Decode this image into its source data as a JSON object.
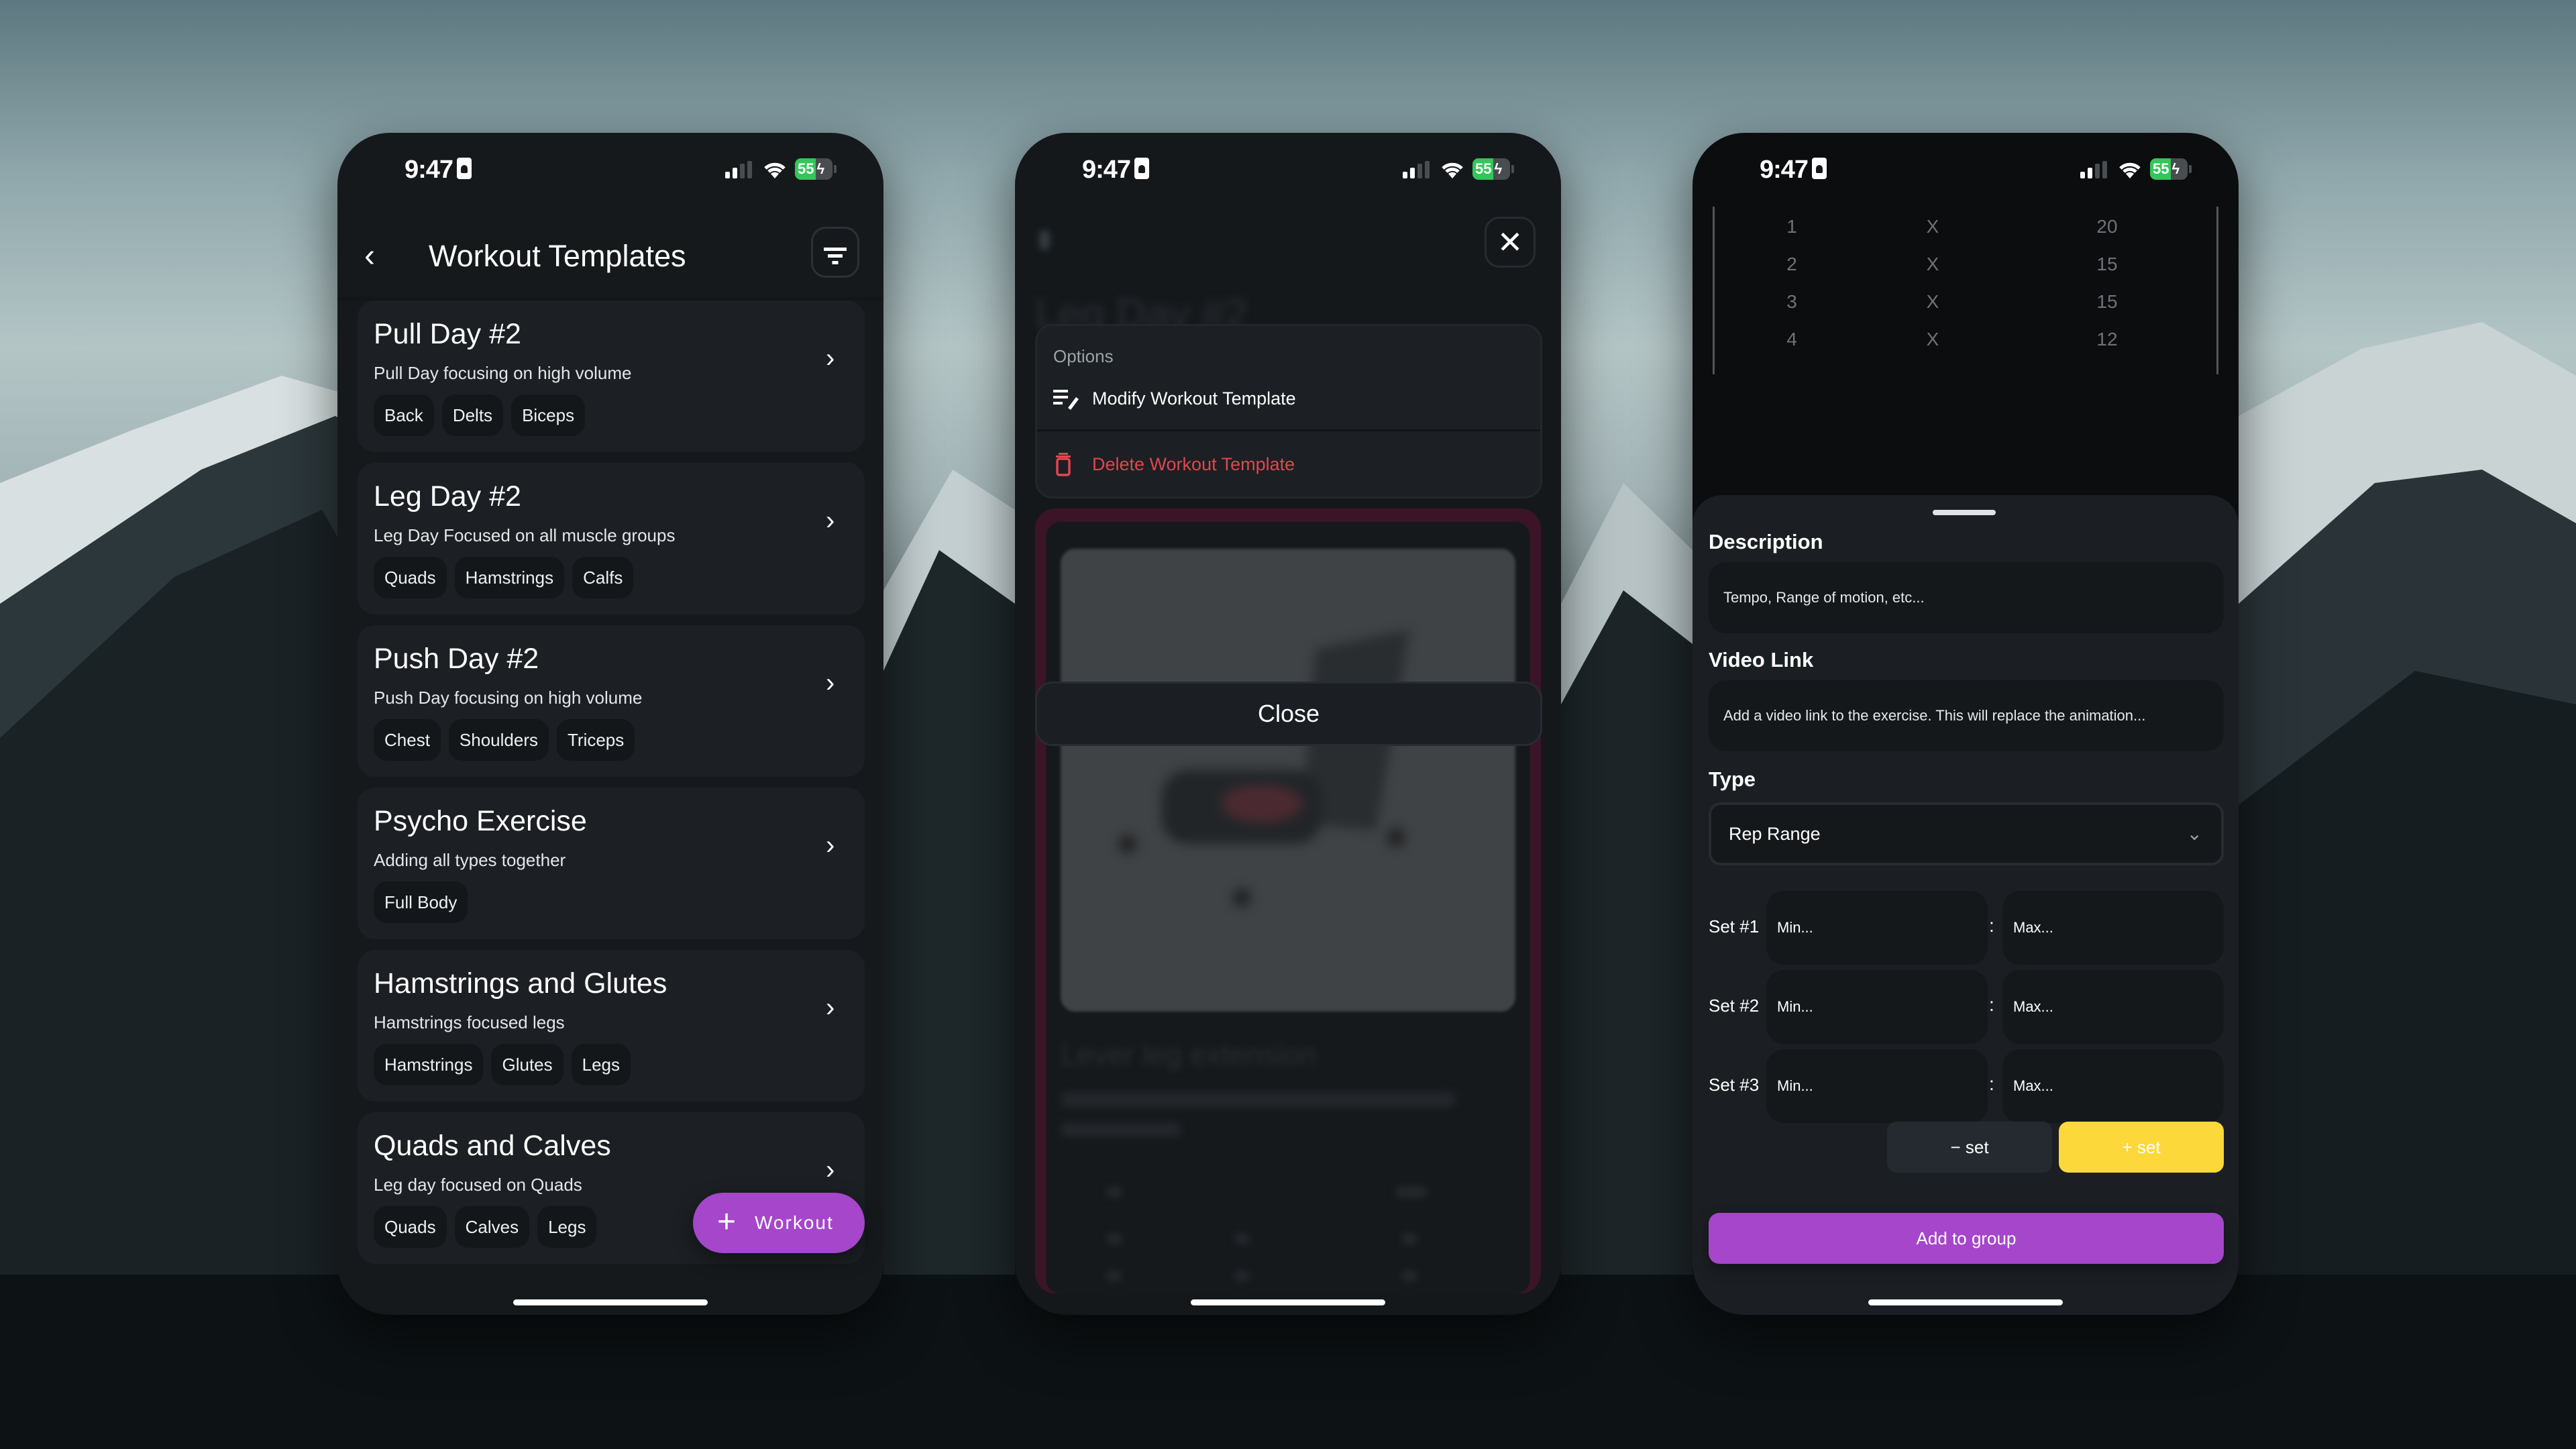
{
  "colors": {
    "accent_purple": "#a546cb",
    "accent_yellow": "#fdd83a",
    "danger_red": "#e0474d",
    "battery_green": "#33c759",
    "card_bg": "#1c1f23",
    "screen_bg": "#16191c"
  },
  "status_bar": {
    "time": "9:47",
    "battery_level": "55",
    "signal_bars_active": 2,
    "signal_bars_total": 4,
    "battery_fraction": 0.55,
    "charging": true
  },
  "screen1": {
    "header": {
      "back_icon": "chevron-left-icon",
      "title": "Workout Templates",
      "filter_icon": "filter-icon"
    },
    "templates": [
      {
        "title": "Pull Day #2",
        "description": "Pull Day focusing on high volume",
        "tags": [
          "Back",
          "Delts",
          "Biceps"
        ]
      },
      {
        "title": "Leg Day #2",
        "description": "Leg Day Focused on all muscle groups",
        "tags": [
          "Quads",
          "Hamstrings",
          "Calfs"
        ]
      },
      {
        "title": "Push Day #2",
        "description": "Push Day focusing on high volume",
        "tags": [
          "Chest",
          "Shoulders",
          "Triceps"
        ]
      },
      {
        "title": "Psycho Exercise",
        "description": "Adding all types together",
        "tags": [
          "Full Body"
        ]
      },
      {
        "title": "Hamstrings and Glutes",
        "description": "Hamstrings focused legs",
        "tags": [
          "Hamstrings",
          "Glutes",
          "Legs"
        ]
      },
      {
        "title": "Quads and Calves",
        "description": "Leg day focused on Quads",
        "tags": [
          "Quads",
          "Calves",
          "Legs"
        ]
      }
    ],
    "chevron_glyph": "›",
    "fab": {
      "plus": "+",
      "label": "Workout"
    }
  },
  "screen2": {
    "background_title": "Leg Day #2",
    "background_exercise_title": "Lever leg extension",
    "close_icon": "✕",
    "options_sheet": {
      "header": "Options",
      "items": [
        {
          "label": "Modify Workout Template",
          "icon": "edit-list-icon"
        },
        {
          "label": "Delete Workout Template",
          "icon": "trash-icon",
          "danger": true
        }
      ]
    },
    "close_button": "Close"
  },
  "screen3": {
    "sets_table": [
      {
        "set": "1",
        "x": "X",
        "reps": "20"
      },
      {
        "set": "2",
        "x": "X",
        "reps": "15"
      },
      {
        "set": "3",
        "x": "X",
        "reps": "15"
      },
      {
        "set": "4",
        "x": "X",
        "reps": "12"
      }
    ],
    "description": {
      "label": "Description",
      "placeholder": "Tempo, Range of motion, etc..."
    },
    "video_link": {
      "label": "Video Link",
      "placeholder": "Add a video link to the exercise. This will replace the animation..."
    },
    "type": {
      "label": "Type",
      "selected": "Rep Range"
    },
    "sets": [
      {
        "label": "Set #1",
        "min_placeholder": "Min...",
        "max_placeholder": "Max..."
      },
      {
        "label": "Set #2",
        "min_placeholder": "Min...",
        "max_placeholder": "Max..."
      },
      {
        "label": "Set #3",
        "min_placeholder": "Min...",
        "max_placeholder": "Max..."
      }
    ],
    "separator": ":",
    "remove_set_button": "−  set",
    "add_set_button": "+  set",
    "add_to_group_button": "Add to group",
    "pager": {
      "pages": 2,
      "active_index": 1
    }
  }
}
